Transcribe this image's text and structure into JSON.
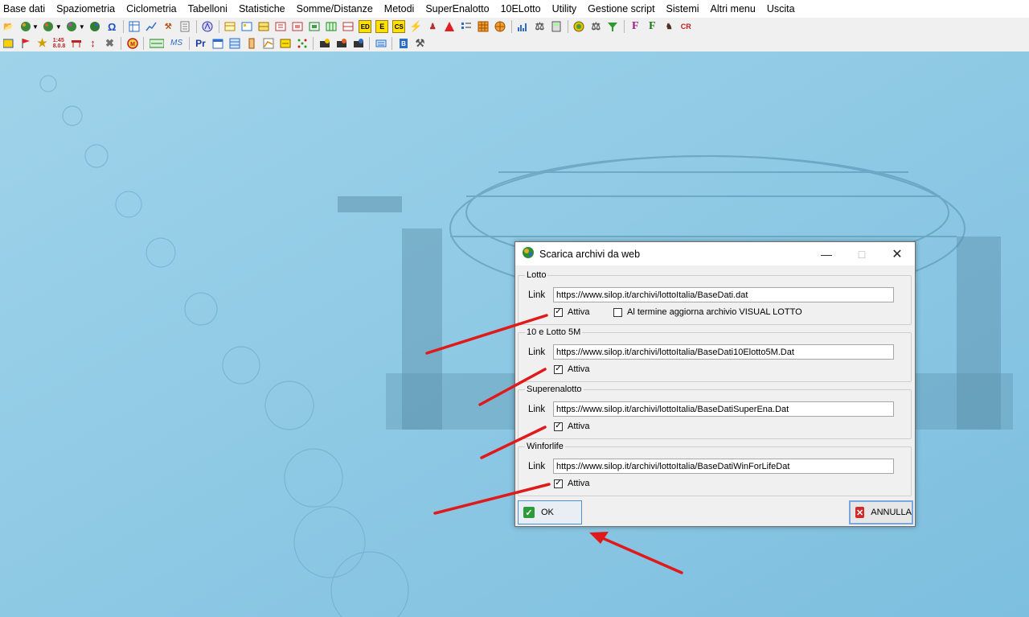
{
  "menu": [
    "Base dati",
    "Spaziometria",
    "Ciclometria",
    "Tabelloni",
    "Statistiche",
    "Somme/Distanze",
    "Metodi",
    "SuperEnalotto",
    "10ELotto",
    "Utility",
    "Gestione script",
    "Sistemi",
    "Altri menu",
    "Uscita"
  ],
  "toolbar1_icons": [
    "folder-open-icon",
    "globe-icon",
    "globe-icon",
    "globe-icon",
    "globe-icon",
    "omega-icon",
    "grid-icon",
    "chart-icon",
    "tools-icon",
    "list-icon",
    "logo-icon",
    "table-icon",
    "table-icon",
    "table-icon",
    "table-icon",
    "table-icon",
    "table-icon",
    "table-icon",
    "table-icon",
    "ed-icon",
    "e-icon",
    "cs-icon",
    "lightning-icon",
    "person-icon",
    "warning-icon",
    "list-icon",
    "grid-icon",
    "wheel-icon",
    "bars-icon",
    "scale-icon",
    "calc-icon",
    "coins-icon",
    "scale-icon",
    "filter-icon",
    "f-icon",
    "f-icon",
    "spy-icon",
    "cr-icon"
  ],
  "toolbar1_text": {
    "ed": "ED",
    "e": "E",
    "cs": "CS",
    "f1": "F",
    "f2": "F",
    "cr": "CR"
  },
  "toolbar2_icons": [
    "table-icon",
    "flag-icon",
    "star-icon",
    "clock-icon",
    "rotate-icon",
    "sum-icon",
    "tools-icon",
    "coin-icon",
    "abc-icon",
    "ms-icon",
    "pr-icon",
    "calendar-icon",
    "calendar-icon",
    "ruler-icon",
    "chart-icon",
    "table-icon",
    "sparkle-icon",
    "folder-icon",
    "folder-icon",
    "folder-icon",
    "keyboard-icon",
    "book-icon",
    "hammer-icon"
  ],
  "toolbar2_text": {
    "ms": "MS",
    "pr": "Pr"
  },
  "dialog": {
    "title": "Scarica archivi da web",
    "groups": [
      {
        "legend": "Lotto",
        "link_label": "Link",
        "link_value": "https://www.silop.it/archivi/lottoItalia/BaseDati.dat",
        "attiva_label": "Attiva",
        "attiva_checked": true,
        "extra_label": "Al termine aggiorna archivio VISUAL LOTTO",
        "extra_checked": false
      },
      {
        "legend": "10 e Lotto 5M",
        "link_label": "Link",
        "link_value": "https://www.silop.it/archivi/lottoItalia/BaseDati10Elotto5M.Dat",
        "attiva_label": "Attiva",
        "attiva_checked": true
      },
      {
        "legend": "Superenalotto",
        "link_label": "Link",
        "link_value": "https://www.silop.it/archivi/lottoItalia/BaseDatiSuperEna.Dat",
        "attiva_label": "Attiva",
        "attiva_checked": true
      },
      {
        "legend": "Winforlife",
        "link_label": "Link",
        "link_value": "https://www.silop.it/archivi/lottoItalia/BaseDatiWinForLifeDat",
        "attiva_label": "Attiva",
        "attiva_checked": true
      }
    ],
    "ok_label": "OK",
    "cancel_label": "ANNULLA"
  },
  "colors": {
    "background": "#8cc7e3",
    "arrow": "#e01a1a",
    "ok_icon": "#2e9b3a",
    "cancel_icon": "#d02a2a"
  }
}
